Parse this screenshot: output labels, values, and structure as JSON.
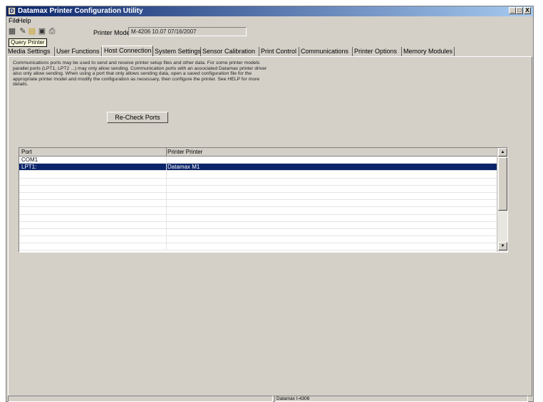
{
  "window": {
    "title": "Datamax Printer Configuration Utility",
    "icon": "app-icon",
    "controls": [
      "_",
      "□",
      "X"
    ]
  },
  "menu": {
    "items": [
      "File",
      "Help"
    ]
  },
  "toolbar": {
    "icons": [
      "query-printer-icon",
      "wrench-icon",
      "open-folder-icon",
      "save-icon",
      "print-icon"
    ],
    "printer_model_label": "Printer Model:",
    "printer_model_value": "M-4206 10.07 07/16/2007",
    "tooltip": "Query Printer"
  },
  "tabs": [
    {
      "label": "Media Settings",
      "active": false
    },
    {
      "label": "User Functions",
      "active": false
    },
    {
      "label": "Host Connection",
      "active": true
    },
    {
      "label": "System Settings",
      "active": false
    },
    {
      "label": "Sensor Calibration",
      "active": false
    },
    {
      "label": "Print Control",
      "active": false
    },
    {
      "label": "Communications",
      "active": false
    },
    {
      "label": "Printer Options",
      "active": false
    },
    {
      "label": "Memory Modules",
      "active": false
    }
  ],
  "host_connection": {
    "description": "Communications ports may be used to send and receive printer setup files and other data. For some printer models parallel ports (LPT1, LPT2 ...) may only allow sending. Communication ports with an associated Datamax printer driver also only allow sending. When using a port that only allows sending data, open a saved configuration file for the appropriate printer model and modify the configuration as necessary, then configure the printer. See HELP for more details.",
    "recheck_button": "Re-Check Ports",
    "columns": [
      "Port",
      "Printer  Printer"
    ],
    "rows": [
      {
        "port": "COM1",
        "printer": "",
        "selected": false
      },
      {
        "port": "LPT1:",
        "printer": "Datamax M1",
        "selected": true
      },
      {
        "port": "",
        "printer": "",
        "selected": false
      },
      {
        "port": "",
        "printer": "",
        "selected": false
      },
      {
        "port": "",
        "printer": "",
        "selected": false
      },
      {
        "port": "",
        "printer": "",
        "selected": false
      },
      {
        "port": "",
        "printer": "",
        "selected": false
      },
      {
        "port": "",
        "printer": "",
        "selected": false
      },
      {
        "port": "",
        "printer": "",
        "selected": false
      },
      {
        "port": "",
        "printer": "",
        "selected": false
      },
      {
        "port": "",
        "printer": "",
        "selected": false
      },
      {
        "port": "",
        "printer": "",
        "selected": false
      },
      {
        "port": "",
        "printer": "",
        "selected": false
      }
    ],
    "scroll_up": "▲",
    "scroll_down": "▼"
  },
  "status": {
    "printer": "Datamax I-4308"
  }
}
